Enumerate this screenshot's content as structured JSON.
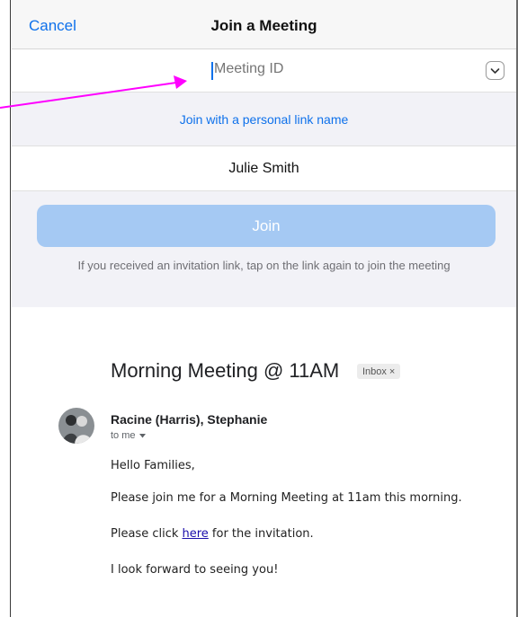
{
  "zoom_dialog": {
    "cancel_label": "Cancel",
    "title": "Join a Meeting",
    "meeting_id_placeholder": "Meeting ID",
    "personal_link_label": "Join with a personal link name",
    "name_value": "Julie Smith",
    "join_label": "Join",
    "hint_text": "If you received an invitation link, tap on the link again to join the meeting",
    "accent_color": "#0e71eb",
    "join_button_color": "#a5c9f3"
  },
  "email": {
    "subject": "Morning Meeting @ 11AM",
    "badge": "Inbox",
    "badge_close": "×",
    "sender": "Racine (Harris), Stephanie",
    "recipient": "to me",
    "greeting": "Hello Families,",
    "line1": "Please join me for a Morning Meeting at 11am this morning.",
    "line2_before": "Please click ",
    "line2_link": "here",
    "line2_after": " for the invitation.",
    "line3": "I look forward to seeing you!"
  },
  "annotation": {
    "arrow_color": "#ff00ff"
  }
}
